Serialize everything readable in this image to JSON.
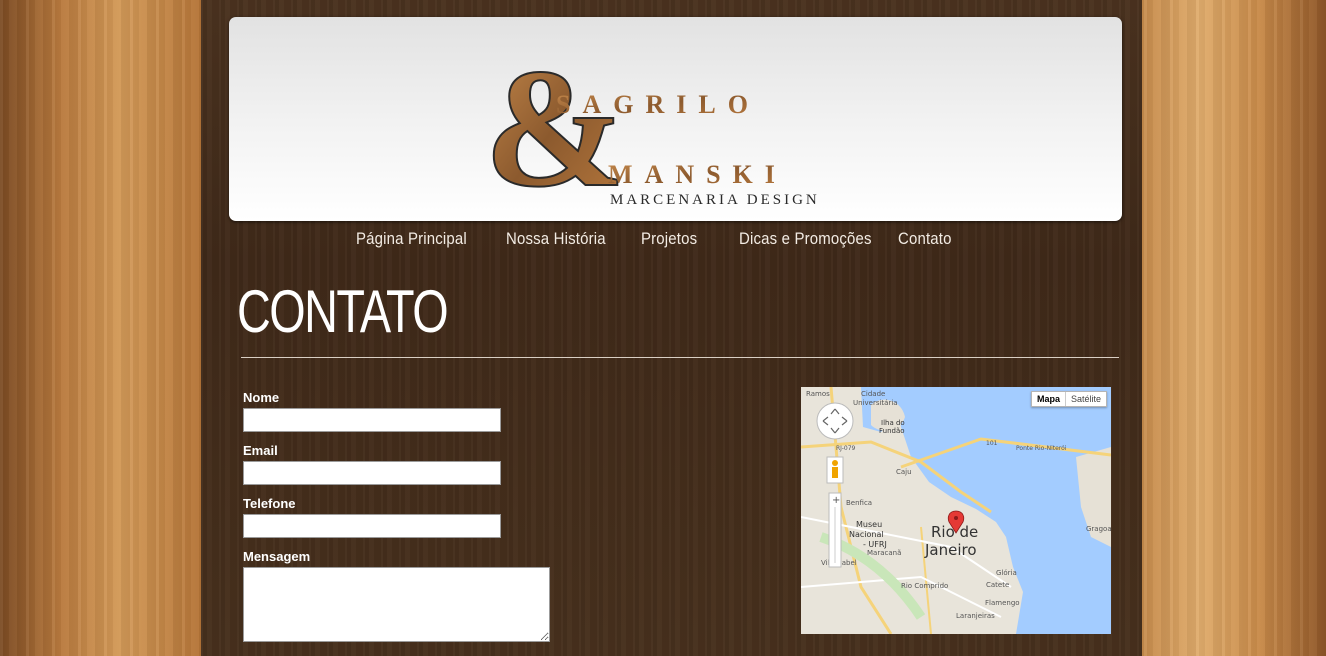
{
  "brand": {
    "logo_text_1": "SAGRILO",
    "logo_text_2": "MANSKI",
    "logo_ampersand": "&",
    "logo_tagline": "MARCENARIA DESIGN"
  },
  "nav": {
    "items": [
      {
        "label": "Página Principal"
      },
      {
        "label": "Nossa História"
      },
      {
        "label": "Projetos"
      },
      {
        "label": "Dicas e Promoções"
      },
      {
        "label": "Contato"
      }
    ]
  },
  "page": {
    "title": "CONTATO"
  },
  "form": {
    "name_label": "Nome",
    "email_label": "Email",
    "phone_label": "Telefone",
    "message_label": "Mensagem",
    "name_value": "",
    "email_value": "",
    "phone_value": "",
    "message_value": ""
  },
  "map": {
    "btn_map": "Mapa",
    "btn_satellite": "Satélite",
    "labels": {
      "city": "Rio de",
      "city2": "Janeiro",
      "ramos": "Ramos",
      "cidade_univ": "Cidade",
      "cidade_univ2": "Universitária",
      "ilha": "Ilha do",
      "ilha2": "Fundão",
      "ponte": "Ponte Rio-Niterói",
      "r101": "101",
      "rj079": "RJ-079",
      "caju": "Caju",
      "museu": "Museu",
      "museu2": "Nacional",
      "ufrj": "- UFRJ",
      "benfica": "Benfica",
      "maracana": "Maracanã",
      "rio_comprido": "Rio Comprido",
      "catete": "Catete",
      "gloria": "Glória",
      "flamengo": "Flamengo",
      "laranjeiras": "Laranjeiras",
      "gragoa": "Gragoa",
      "vila_isabel": "Vila Isabel"
    }
  }
}
